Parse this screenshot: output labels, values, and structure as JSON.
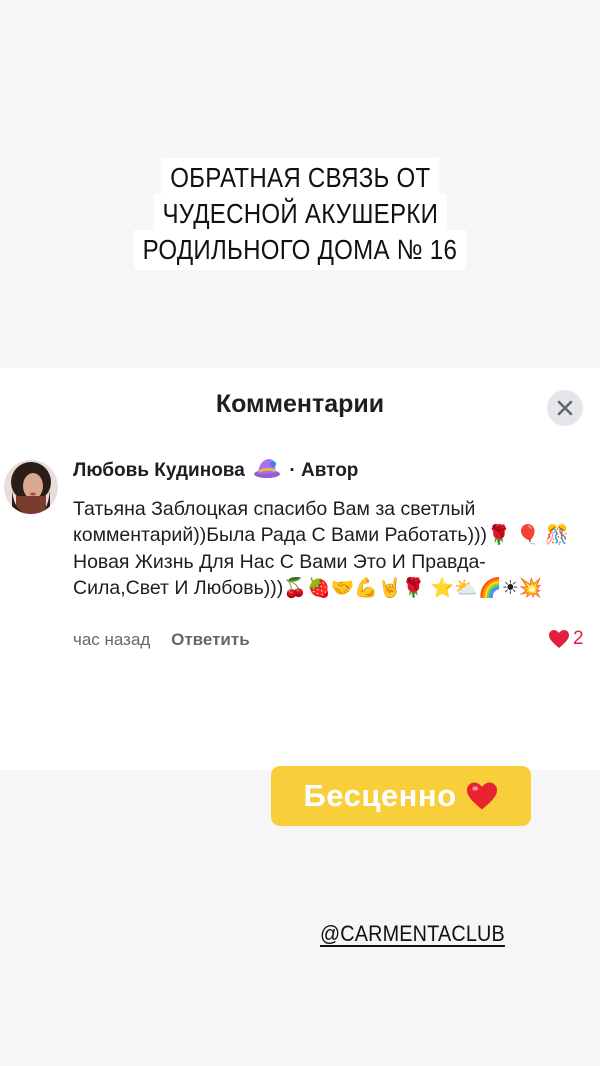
{
  "headline": {
    "lines": [
      "ОБРАТНАЯ СВЯЗЬ ОТ",
      "ЧУДЕСНОЙ АКУШЕРКИ",
      "РОДИЛЬНОГО ДОМА № 16"
    ]
  },
  "comments_panel": {
    "title": "Комментарии",
    "close_icon": "close-icon"
  },
  "comment": {
    "author": "Любовь Кудинова",
    "author_badge_icon": "hat-emoji",
    "separator": "·",
    "role": "Автор",
    "text_line1": "Татьяна Заблоцкая спасибо Вам за светлый",
    "text_line2": "комментарий))Была Рада С Вами Работать)))",
    "text_line3": "Новая Жизнь Для Нас С Вами Это И",
    "text_line4": "Правда-Сила,Свет И Любовь)))",
    "emoji": {
      "rose": "🌹",
      "balloon": "🎈",
      "confetti": "🎊",
      "cherries": "🍒",
      "strawberry": "🍓",
      "handshake": "🤝",
      "muscle": "💪",
      "rock": "🤘",
      "star": "⭐",
      "cloud": "⛅",
      "rainbow": "🌈",
      "sun": "☀",
      "boom": "💥"
    },
    "time": "час назад",
    "reply_label": "Ответить",
    "like_count": "2",
    "like_color": "#e41e3f"
  },
  "sticker": {
    "text": "Бесценно",
    "heart_icon": "red-heart-icon",
    "color": "#f8cf3b"
  },
  "handle": "@CARMENTACLUB"
}
